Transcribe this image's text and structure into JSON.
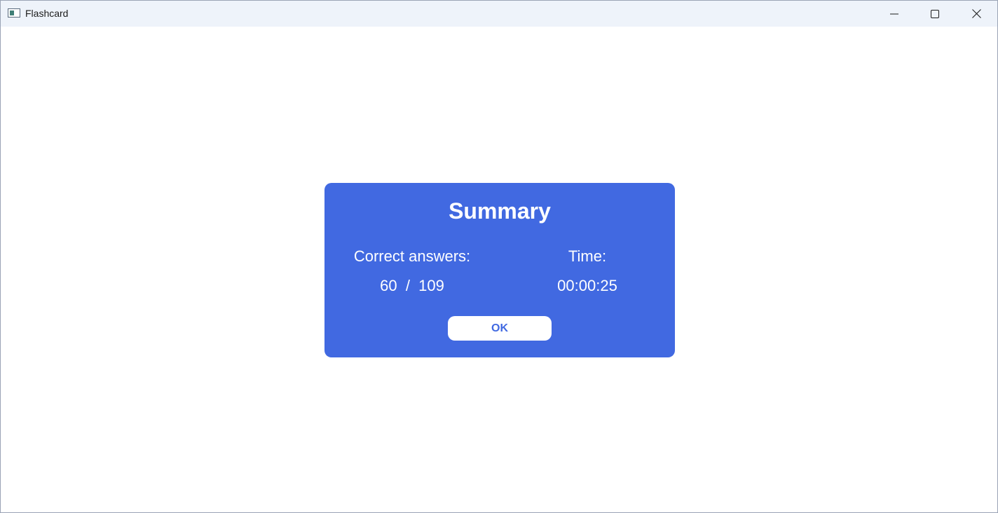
{
  "window": {
    "title": "Flashcard",
    "icon": "app-window-icon",
    "controls": [
      "minimize-icon",
      "maximize-icon",
      "close-icon"
    ]
  },
  "summary": {
    "title": "Summary",
    "correct_label": "Correct answers:",
    "correct_value": "60  /  109",
    "time_label": "Time:",
    "time_value": "00:00:25",
    "ok_label": "OK"
  },
  "colors": {
    "dialog_background": "#4169e1",
    "dialog_text": "#ffffff",
    "button_background": "#ffffff",
    "button_text": "#4169e1",
    "titlebar_background": "#eef3fa"
  }
}
